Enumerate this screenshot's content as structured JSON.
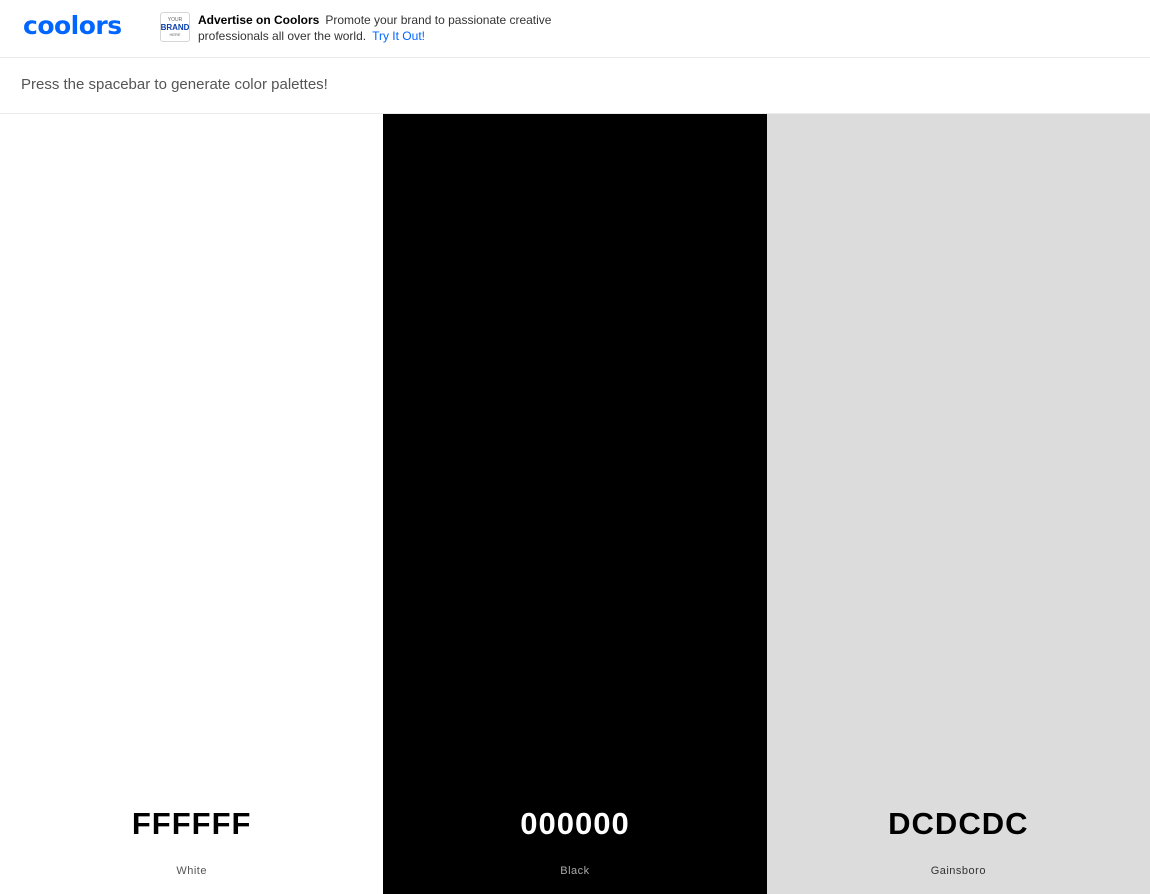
{
  "header": {
    "logo": "coolors",
    "ad_badge": {
      "line1": "YOUR",
      "line2": "BRAND",
      "line3": "HERE"
    },
    "ad_title": "Advertise on Coolors",
    "ad_description": "Promote your brand to passionate creative professionals all over the world.",
    "ad_link": "Try It Out!",
    "accent_color": "#0066ff"
  },
  "hint": "Press the spacebar to generate color palettes!",
  "palette": [
    {
      "hex": "FFFFFF",
      "name": "White",
      "color": "#ffffff",
      "text_color": "#000000",
      "name_color": "#555555"
    },
    {
      "hex": "000000",
      "name": "Black",
      "color": "#000000",
      "text_color": "#ffffff",
      "name_color": "#aaaaaa"
    },
    {
      "hex": "DCDCDC",
      "name": "Gainsboro",
      "color": "#dcdcdc",
      "text_color": "#000000",
      "name_color": "#333333"
    }
  ]
}
